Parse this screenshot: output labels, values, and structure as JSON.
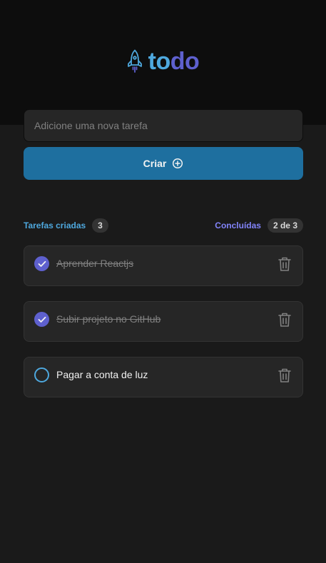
{
  "app": {
    "logo_part1": "to",
    "logo_part2": "do",
    "logo_icon": "rocket-icon"
  },
  "new_task": {
    "placeholder": "Adicione uma nova tarefa",
    "value": ""
  },
  "create_button": {
    "label": "Criar",
    "icon": "plus-circle-icon"
  },
  "summary": {
    "created_label": "Tarefas criadas",
    "created_count": "3",
    "done_label": "Concluídas",
    "done_count": "2 de 3"
  },
  "tasks": [
    {
      "text": "Aprender Reactjs",
      "completed": true
    },
    {
      "text": "Subir projeto no GitHub",
      "completed": true
    },
    {
      "text": "Pagar a conta de luz",
      "completed": false
    }
  ],
  "colors": {
    "brand_blue": "#4ea8de",
    "brand_purple": "#5e60ce",
    "button_blue": "#1e6f9f",
    "background": "#1a1a1a",
    "header_background": "#0d0d0d",
    "card_background": "#262626"
  }
}
